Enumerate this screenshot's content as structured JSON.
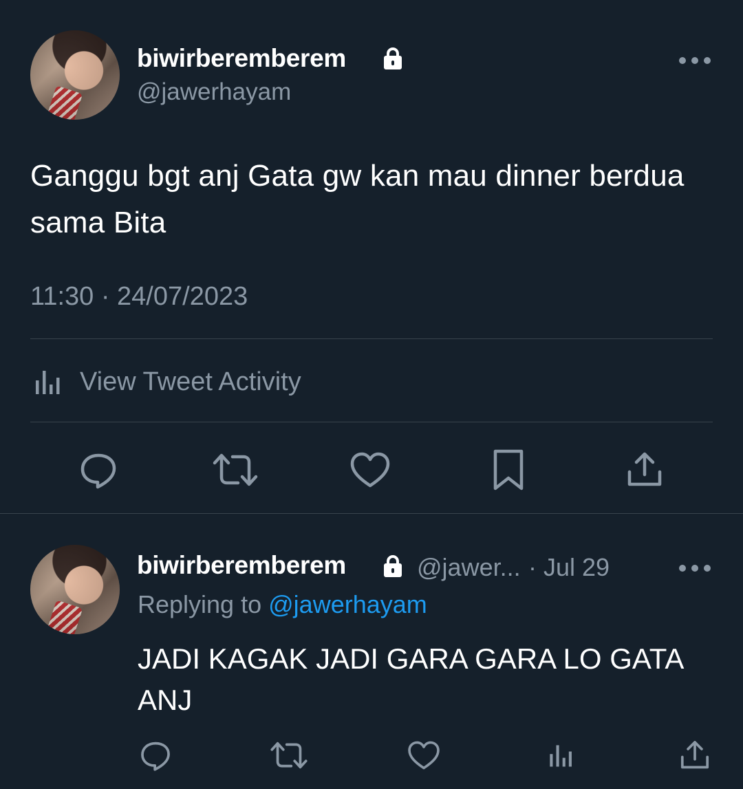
{
  "main_tweet": {
    "display_name": "biwirberemberem",
    "handle": "@jawerhayam",
    "text": "Ganggu bgt anj Gata gw kan mau dinner berdua sama Bita",
    "timestamp": "11:30 · 24/07/2023",
    "activity_label": "View Tweet Activity",
    "icons": [
      "lock-icon",
      "more-icon",
      "analytics-icon",
      "reply-icon",
      "retweet-icon",
      "like-icon",
      "bookmark-icon",
      "share-icon"
    ]
  },
  "reply": {
    "display_name": "biwirberemberem",
    "handle_truncated": "@jawer...",
    "separator": "·",
    "date": "Jul 29",
    "replying_to_prefix": "Replying to",
    "replying_to_handle": "@jawerhayam",
    "text": "JADI KAGAK JADI GARA GARA LO GATA ANJ",
    "icons": [
      "reply-icon",
      "retweet-icon",
      "like-icon",
      "analytics-icon",
      "share-icon"
    ]
  },
  "colors": {
    "background": "#15202b",
    "primary_text": "#ffffff",
    "secondary_text": "#8b98a5",
    "link": "#1d9bf0",
    "divider": "#38444d"
  }
}
